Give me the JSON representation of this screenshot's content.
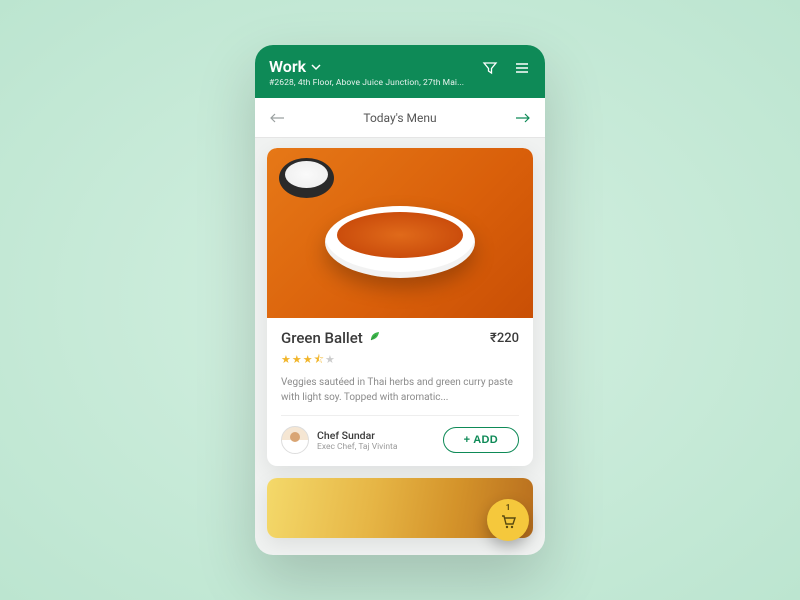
{
  "header": {
    "location_label": "Work",
    "address": "#2628, 4th Floor, Above Juice Junction, 27th Mai..."
  },
  "subheader": {
    "title": "Today's Menu"
  },
  "dish": {
    "name": "Green Ballet",
    "price": "₹220",
    "rating_full": 3,
    "rating_half": 1,
    "description": "Veggies sautéed in Thai herbs and green curry paste with light soy. Topped with aromatic...",
    "chef_name": "Chef Sundar",
    "chef_title": "Exec Chef, Taj Vivinta",
    "add_label": "+ ADD"
  },
  "cart": {
    "count": "1"
  }
}
